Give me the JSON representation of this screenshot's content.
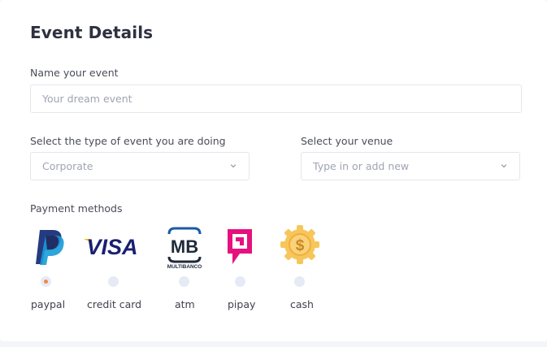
{
  "form": {
    "title": "Event Details",
    "name_label": "Name your event",
    "name_placeholder": "Your dream event",
    "type_label": "Select the type of event you are doing",
    "type_value": "Corporate",
    "venue_label": "Select your venue",
    "venue_placeholder": "Type in or add new",
    "payment_label": "Payment methods"
  },
  "payment_methods": [
    {
      "label": "paypal",
      "selected": true
    },
    {
      "label": "credit card",
      "selected": false
    },
    {
      "label": "atm",
      "selected": false
    },
    {
      "label": "pipay",
      "selected": false
    },
    {
      "label": "cash",
      "selected": false
    }
  ],
  "logos": {
    "visa_text": "VISA",
    "mb_text": "MB",
    "multibanco_text": "MULTIBANCO",
    "cash_symbol": "$"
  },
  "colors": {
    "accent": "#f08a3c",
    "paypal_dark": "#253b80",
    "paypal_light": "#179bd7",
    "visa": "#1a1f71",
    "visa_gold": "#f7b600",
    "pipay": "#e6117e",
    "cash_gold": "#f7c65a"
  }
}
